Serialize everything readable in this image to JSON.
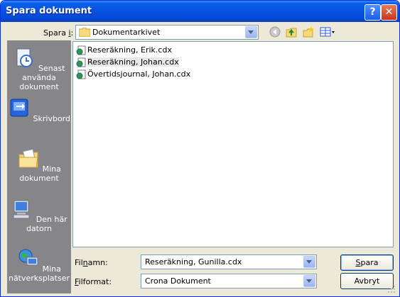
{
  "title": "Spara dokument",
  "title_buttons": {
    "help": "?",
    "close": "✕"
  },
  "save_in": {
    "label_prefix": "Spara ",
    "label_key": "i",
    "label_suffix": ":",
    "value": "Dokumentarkivet"
  },
  "places": [
    {
      "label": "Senast använda dokument",
      "icon": "recent-documents-icon"
    },
    {
      "label": "Skrivbord",
      "icon": "desktop-icon"
    },
    {
      "label": "Mina dokument",
      "icon": "my-documents-icon"
    },
    {
      "label": "Den här datorn",
      "icon": "my-computer-icon"
    },
    {
      "label": "Mina nätverksplatser",
      "icon": "network-places-icon"
    }
  ],
  "files": [
    {
      "name": "Reseräkning, Erik.cdx"
    },
    {
      "name": "Reseräkning, Johan.cdx"
    },
    {
      "name": "Övertidsjournal, Johan.cdx"
    }
  ],
  "filename": {
    "label_prefix": "Fil",
    "label_key": "n",
    "label_suffix": "amn:",
    "value": "Reseräkning, Gunilla.cdx"
  },
  "fileformat": {
    "label_key": "F",
    "label_suffix": "ilformat:",
    "value": "Crona Dokument"
  },
  "buttons": {
    "save_key": "S",
    "save_rest": "para",
    "cancel": "Avbryt"
  },
  "toolbar": [
    "back-icon",
    "up-folder-icon",
    "new-folder-icon",
    "view-menu-icon"
  ]
}
